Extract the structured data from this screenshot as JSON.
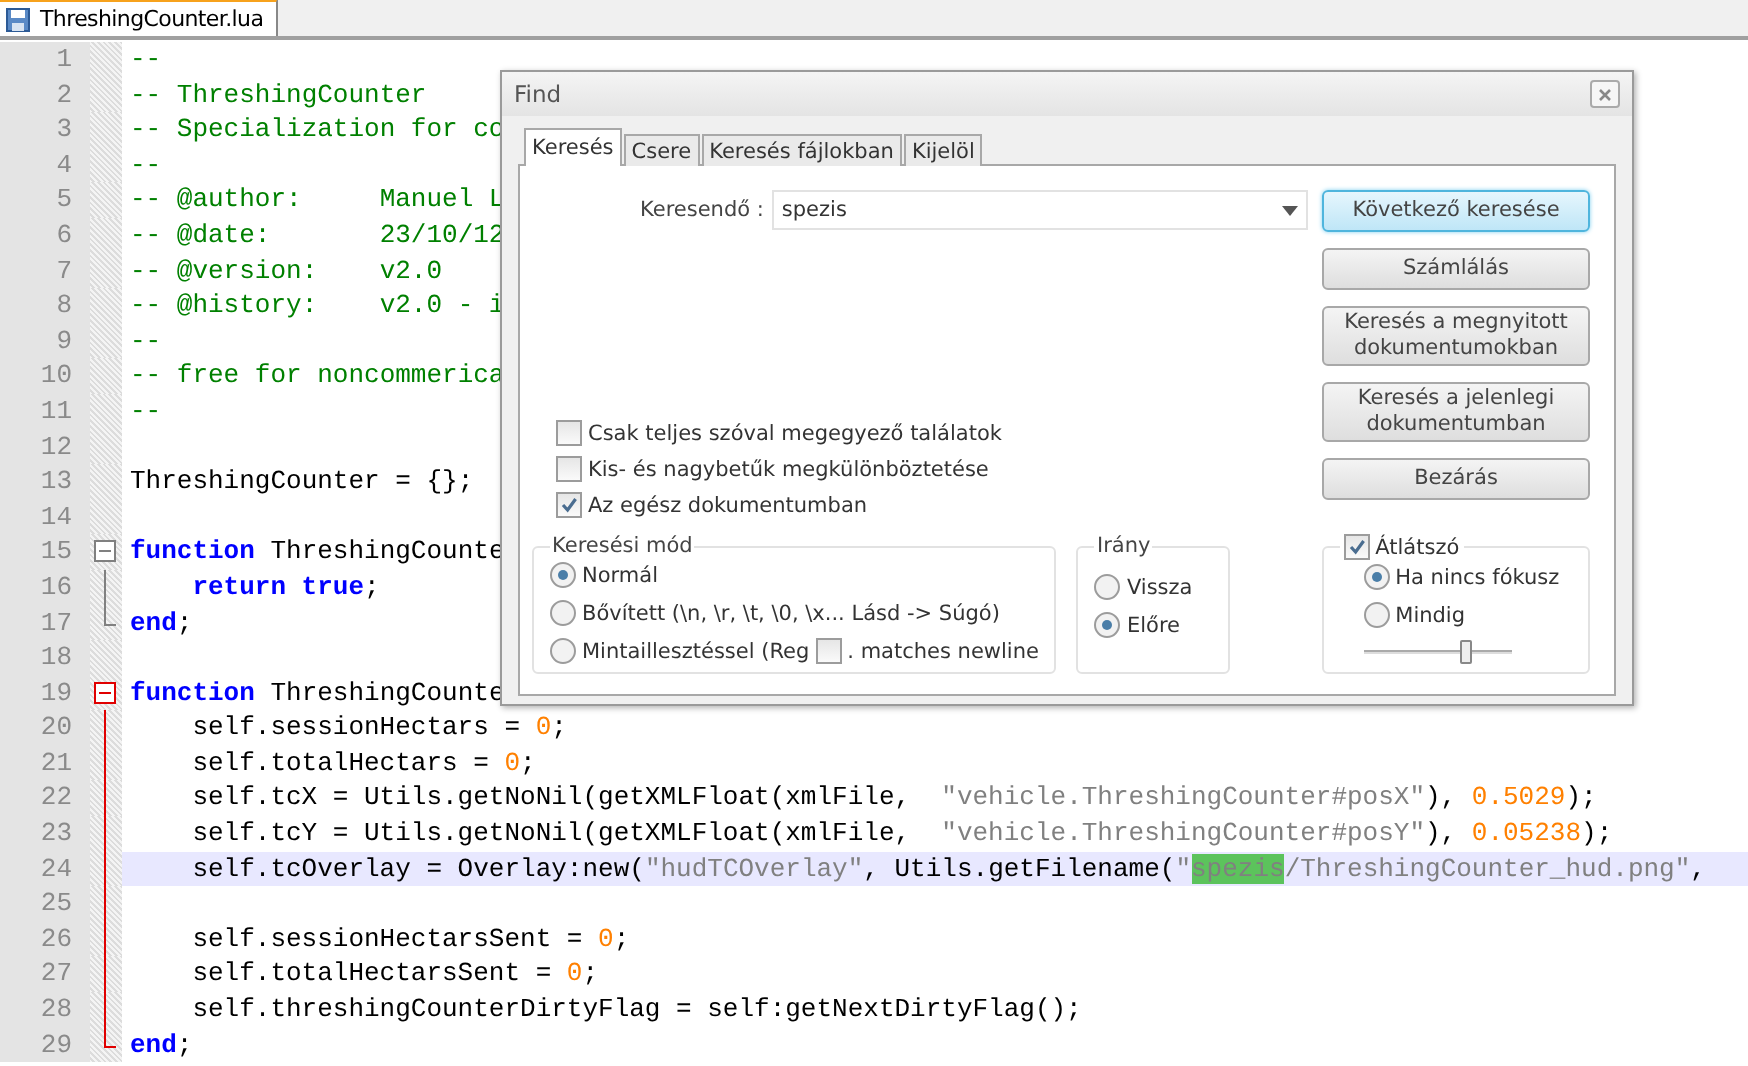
{
  "tab_bar": {
    "tabs": [
      {
        "label": "ThreshingCounter.lua",
        "selected": true
      }
    ]
  },
  "editor": {
    "lines": [
      {
        "number": "1",
        "tokens": [
          {
            "kind": "comment",
            "text": "--"
          }
        ]
      },
      {
        "number": "2",
        "tokens": [
          {
            "kind": "comment",
            "text": "-- ThreshingCounter"
          }
        ]
      },
      {
        "number": "3",
        "tokens": [
          {
            "kind": "comment",
            "text": "-- Specialization for co"
          }
        ]
      },
      {
        "number": "4",
        "tokens": [
          {
            "kind": "comment",
            "text": "--"
          }
        ]
      },
      {
        "number": "5",
        "tokens": [
          {
            "kind": "comment",
            "text": "-- @author:     Manuel L"
          }
        ]
      },
      {
        "number": "6",
        "tokens": [
          {
            "kind": "comment",
            "text": "-- @date:       23/10/12"
          }
        ]
      },
      {
        "number": "7",
        "tokens": [
          {
            "kind": "comment",
            "text": "-- @version:    v2.0"
          }
        ]
      },
      {
        "number": "8",
        "tokens": [
          {
            "kind": "comment",
            "text": "-- @history:    v2.0 - i"
          }
        ]
      },
      {
        "number": "9",
        "tokens": [
          {
            "kind": "comment",
            "text": "--"
          }
        ]
      },
      {
        "number": "10",
        "tokens": [
          {
            "kind": "comment",
            "text": "-- free for noncommerica"
          }
        ]
      },
      {
        "number": "11",
        "tokens": [
          {
            "kind": "comment",
            "text": "--"
          }
        ]
      },
      {
        "number": "12"
      },
      {
        "number": "13",
        "tokens": [
          {
            "kind": "plain",
            "text": "ThreshingCounter = {};"
          }
        ]
      },
      {
        "number": "14"
      },
      {
        "number": "15",
        "fold": {
          "kind": "start",
          "active": false
        },
        "tokens": [
          {
            "kind": "keyword",
            "text": "function"
          },
          {
            "kind": "plain",
            "text": " ThreshingCounte"
          }
        ]
      },
      {
        "number": "16",
        "fold": {
          "kind": "body",
          "active": false
        },
        "indented": true,
        "tokens": [
          {
            "kind": "keyword",
            "text": "return true"
          },
          {
            "kind": "plain",
            "text": ";"
          }
        ]
      },
      {
        "number": "17",
        "fold": {
          "kind": "end",
          "active": false
        },
        "tokens": [
          {
            "kind": "keyword",
            "text": "end"
          },
          {
            "kind": "plain",
            "text": ";"
          }
        ]
      },
      {
        "number": "18"
      },
      {
        "number": "19",
        "fold": {
          "kind": "start",
          "active": true
        },
        "tokens": [
          {
            "kind": "keyword",
            "text": "function"
          },
          {
            "kind": "plain",
            "text": " ThreshingCounte"
          }
        ]
      },
      {
        "number": "20",
        "fold": {
          "kind": "body",
          "active": true
        },
        "indented": true,
        "tokens": [
          {
            "kind": "plain",
            "text": "self.sessionHectars = "
          },
          {
            "kind": "number",
            "text": "0"
          },
          {
            "kind": "plain",
            "text": ";"
          }
        ]
      },
      {
        "number": "21",
        "fold": {
          "kind": "body",
          "active": true
        },
        "indented": true,
        "tokens": [
          {
            "kind": "plain",
            "text": "self.totalHectars = "
          },
          {
            "kind": "number",
            "text": "0"
          },
          {
            "kind": "plain",
            "text": ";"
          }
        ]
      },
      {
        "number": "22",
        "fold": {
          "kind": "body",
          "active": true
        },
        "indented": true,
        "tokens": [
          {
            "kind": "plain",
            "text": "self.tcX = Utils.getNoNil(getXMLFloat(xmlFile,  "
          },
          {
            "kind": "string",
            "text": "\"vehicle.ThreshingCounter#posX\""
          },
          {
            "kind": "plain",
            "text": "), "
          },
          {
            "kind": "number",
            "text": "0.5029"
          },
          {
            "kind": "plain",
            "text": ");"
          }
        ]
      },
      {
        "number": "23",
        "fold": {
          "kind": "body",
          "active": true
        },
        "indented": true,
        "tokens": [
          {
            "kind": "plain",
            "text": "self.tcY = Utils.getNoNil(getXMLFloat(xmlFile,  "
          },
          {
            "kind": "string",
            "text": "\"vehicle.ThreshingCounter#posY\""
          },
          {
            "kind": "plain",
            "text": "), "
          },
          {
            "kind": "number",
            "text": "0.05238"
          },
          {
            "kind": "plain",
            "text": ");"
          }
        ]
      },
      {
        "number": "24",
        "fold": {
          "kind": "body",
          "active": true
        },
        "indented": true,
        "current": true,
        "tokens": [
          {
            "kind": "plain",
            "text": "self.tcOverlay = Overlay:new("
          },
          {
            "kind": "string",
            "text": "\"hudTCOverlay\""
          },
          {
            "kind": "plain",
            "text": ", Utils.getFilename("
          },
          {
            "kind": "string",
            "text": "\""
          },
          {
            "kind": "match",
            "text": "spezis"
          },
          {
            "kind": "string",
            "text": "/ThreshingCounter_hud.png\""
          },
          {
            "kind": "plain",
            "text": ","
          }
        ]
      },
      {
        "number": "25",
        "fold": {
          "kind": "body",
          "active": true
        }
      },
      {
        "number": "26",
        "fold": {
          "kind": "body",
          "active": true
        },
        "indented": true,
        "tokens": [
          {
            "kind": "plain",
            "text": "self.sessionHectarsSent = "
          },
          {
            "kind": "number",
            "text": "0"
          },
          {
            "kind": "plain",
            "text": ";"
          }
        ]
      },
      {
        "number": "27",
        "fold": {
          "kind": "body",
          "active": true
        },
        "indented": true,
        "tokens": [
          {
            "kind": "plain",
            "text": "self.totalHectarsSent = "
          },
          {
            "kind": "number",
            "text": "0"
          },
          {
            "kind": "plain",
            "text": ";"
          }
        ]
      },
      {
        "number": "28",
        "fold": {
          "kind": "body",
          "active": true
        },
        "indented": true,
        "tokens": [
          {
            "kind": "plain",
            "text": "self.threshingCounterDirtyFlag = self:getNextDirtyFlag();"
          }
        ]
      },
      {
        "number": "29",
        "fold": {
          "kind": "end",
          "active": true
        },
        "tokens": [
          {
            "kind": "keyword",
            "text": "end"
          },
          {
            "kind": "plain",
            "text": ";"
          }
        ]
      }
    ]
  },
  "find_dialog": {
    "title": "Find",
    "tabs": [
      {
        "label": "Keresés",
        "selected": true
      },
      {
        "label": "Csere",
        "selected": false
      },
      {
        "label": "Keresés fájlokban",
        "selected": false
      },
      {
        "label": "Kijelöl",
        "selected": false
      }
    ],
    "search": {
      "label": "Keresendő :",
      "value": "spezis"
    },
    "options": [
      {
        "label": "Csak teljes szóval megegyező találatok",
        "checked": false
      },
      {
        "label": "Kis- és nagybetűk megkülönböztetése",
        "checked": false
      },
      {
        "label": "Az egész dokumentumban",
        "checked": true
      }
    ],
    "buttons": [
      {
        "label": "Következő keresése",
        "default": true
      },
      {
        "label": "Számlálás",
        "default": false
      },
      {
        "label": "Keresés a megnyitott dokumentumokban",
        "default": false
      },
      {
        "label": "Keresés a jelenlegi dokumentumban",
        "default": false
      },
      {
        "label": "Bezárás",
        "default": false
      }
    ],
    "search_mode": {
      "title": "Keresési mód",
      "options": [
        {
          "label": "Normál",
          "selected": true
        },
        {
          "label": "Bővített (\\n, \\r, \\t, \\0, \\x... Lásd -> Súgó)",
          "selected": false
        },
        {
          "label": "Mintaillesztéssel (Reg",
          "selected": false
        }
      ],
      "newline": {
        "label": ". matches newline",
        "checked": false
      }
    },
    "direction": {
      "title": "Irány",
      "options": [
        {
          "label": "Vissza",
          "selected": false
        },
        {
          "label": "Előre",
          "selected": true
        }
      ]
    },
    "transparency": {
      "label": "Átlátszó",
      "checked": true,
      "options": [
        {
          "label": "Ha nincs fókusz",
          "selected": true
        },
        {
          "label": "Mindig",
          "selected": false
        }
      ],
      "level": 0.68
    }
  }
}
